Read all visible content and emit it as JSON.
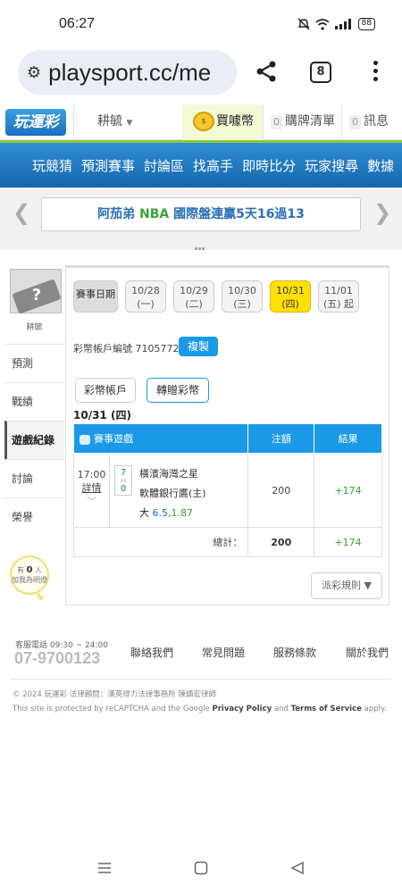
{
  "status_bar": {
    "time": "06:27",
    "battery": "88"
  },
  "browser": {
    "url": "playsport.cc/me",
    "tab_count": "8"
  },
  "header": {
    "logo": "玩運彩",
    "username": "耕毓",
    "buy_coin": "買噱幣",
    "cart_count": "0",
    "cart_label": "購牌清單",
    "msg_count": "0",
    "msg_label": "訊息"
  },
  "nav": {
    "items": [
      "玩競猜",
      "預測賽事",
      "討論區",
      "找高手",
      "即時比分",
      "玩家搜尋",
      "數據"
    ]
  },
  "marquee": {
    "prefix": "阿茄弟 ",
    "highlight": "NBA",
    "suffix": " 國際盤連贏5天16過13"
  },
  "sidebar": {
    "name": "耕毓",
    "items": [
      "預測",
      "戰績",
      "遊戲紀錄",
      "討論",
      "榮譽"
    ],
    "supporters_prefix": "有",
    "supporters_count": "0",
    "supporters_unit": "人",
    "supporters_suffix": "加我為明燈"
  },
  "panel": {
    "date_label": "賽事日期",
    "dates": [
      {
        "d": "10/28",
        "w": "(一)"
      },
      {
        "d": "10/29",
        "w": "(二)"
      },
      {
        "d": "10/30",
        "w": "(三)"
      },
      {
        "d": "10/31",
        "w": "(四)"
      },
      {
        "d": "11/01",
        "w": "(五) 起"
      }
    ],
    "account_text": "彩幣帳戶編號 71057726",
    "copy": "複製",
    "tab_account": "彩幣帳戶",
    "tab_gift": "轉贈彩幣",
    "day_heading": "10/31 (四)",
    "table": {
      "col_game": "賽事遊戲",
      "col_amount": "注額",
      "col_result": "結果",
      "row": {
        "time": "17:00",
        "detail": "詳情",
        "home_no": "7",
        "vs": "vs",
        "away_no": "0",
        "team1": "橫濱海灣之星",
        "team2": "軟體銀行鷹(主)",
        "pick": "大",
        "line": "6.5",
        "odds": "1.87",
        "amount": "200",
        "result": "+174"
      },
      "total_label": "總計：",
      "total_amount": "200",
      "total_result": "+174"
    },
    "rules": "派彩規則 ▼"
  },
  "footer": {
    "tel_label": "客服電話 09:30 ~ 24:00",
    "tel": "07-9700123",
    "links": [
      "聯絡我們",
      "常見問題",
      "服務條款",
      "關於我們"
    ],
    "copyright": "© 2024 玩運彩 法律顧問：漢英得力法律事務所 陳鎮宏律師",
    "recaptcha_prefix": "This site is protected by reCAPTCHA and the Google ",
    "privacy": "Privacy Policy",
    "and": " and ",
    "terms": "Terms of Service",
    "apply": " apply."
  }
}
